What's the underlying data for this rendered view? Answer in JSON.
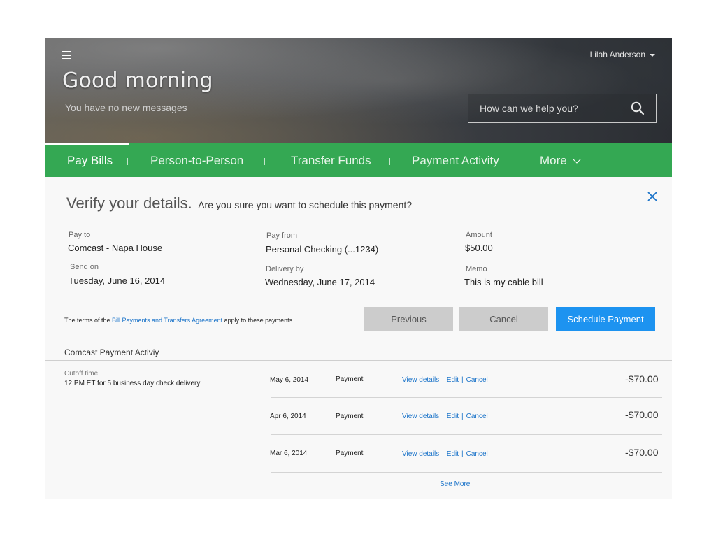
{
  "header": {
    "greeting": "Good morning",
    "messages": "You have no new messages",
    "user_name": "Lilah Anderson",
    "search_placeholder": "How can we help you?"
  },
  "nav": {
    "items": [
      {
        "label": "Pay Bills",
        "active": true
      },
      {
        "label": "Person-to-Person"
      },
      {
        "label": "Transfer Funds"
      },
      {
        "label": "Payment Activity"
      },
      {
        "label": "More"
      }
    ]
  },
  "verify": {
    "title": "Verify your details.",
    "question": "Are you sure you want to schedule this payment?",
    "pay_to_label": "Pay to",
    "pay_to_value": "Comcast - Napa House",
    "pay_from_label": "Pay from",
    "pay_from_value": "Personal Checking (...1234)",
    "amount_label": "Amount",
    "amount_value": "$50.00",
    "send_on_label": "Send on",
    "send_on_value": "Tuesday,  June 16, 2014",
    "delivery_label": "Delivery by",
    "delivery_value": "Wednesday,  June 17, 2014",
    "memo_label": "Memo",
    "memo_value": "This is my cable bill",
    "terms_prefix": "The terms of the ",
    "terms_link": "Bill Payments and Transfers Agreement",
    "terms_suffix": " apply to these payments.",
    "previous_label": "Previous",
    "cancel_label": "Cancel",
    "schedule_label": "Schedule Payment"
  },
  "activity": {
    "title": "Comcast Payment Activiy",
    "cutoff_label": "Cutoff time:",
    "cutoff_value": "12 PM ET for 5 business day check delivery",
    "rows": [
      {
        "date": "May 6, 2014",
        "type": "Payment",
        "amount": "-$70.00"
      },
      {
        "date": "Apr 6, 2014",
        "type": "Payment",
        "amount": "-$70.00"
      },
      {
        "date": "Mar 6, 2014",
        "type": "Payment",
        "amount": "-$70.00"
      }
    ],
    "action_view": "View details",
    "action_edit": "Edit",
    "action_cancel": "Cancel",
    "action_sep": "|",
    "see_more": "See More"
  },
  "colors": {
    "nav_green": "#34a853",
    "primary_blue": "#1d93f0",
    "link_blue": "#1a73c9"
  }
}
